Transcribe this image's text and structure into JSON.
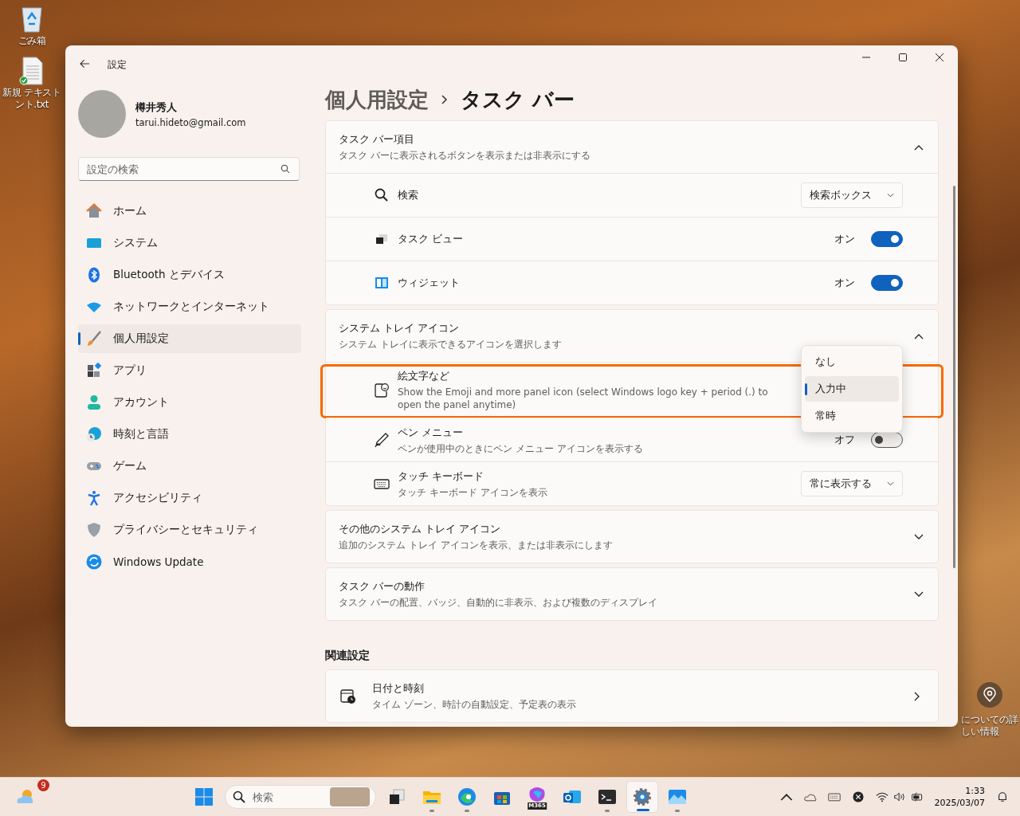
{
  "desktop": {
    "icons": [
      {
        "kind": "recycle-bin",
        "lines": [
          "ごみ箱"
        ]
      },
      {
        "kind": "text-file",
        "lines": [
          "新規 テキスト",
          "ント.txt"
        ]
      }
    ],
    "spotlight": {
      "lines": [
        "についての詳",
        "しい情報"
      ]
    }
  },
  "window": {
    "title": "設定"
  },
  "account": {
    "name": "樽井秀人",
    "email": "tarui.hideto@gmail.com"
  },
  "search": {
    "placeholder": "設定の検索"
  },
  "nav": [
    {
      "kind": "home",
      "label": "ホーム",
      "selected": false
    },
    {
      "kind": "system",
      "label": "システム",
      "selected": false
    },
    {
      "kind": "bluetooth",
      "label": "Bluetooth とデバイス",
      "selected": false
    },
    {
      "kind": "network",
      "label": "ネットワークとインターネット",
      "selected": false
    },
    {
      "kind": "brush",
      "label": "個人用設定",
      "selected": true
    },
    {
      "kind": "apps",
      "label": "アプリ",
      "selected": false
    },
    {
      "kind": "account",
      "label": "アカウント",
      "selected": false
    },
    {
      "kind": "time",
      "label": "時刻と言語",
      "selected": false
    },
    {
      "kind": "gaming",
      "label": "ゲーム",
      "selected": false
    },
    {
      "kind": "accessibility",
      "label": "アクセシビリティ",
      "selected": false
    },
    {
      "kind": "shield",
      "label": "プライバシーとセキュリティ",
      "selected": false
    },
    {
      "kind": "update",
      "label": "Windows Update",
      "selected": false
    }
  ],
  "breadcrumb": {
    "parent": "個人用設定",
    "current": "タスク バー"
  },
  "sections": [
    {
      "title": "タスク バー項目",
      "subtitle": "タスク バーに表示されるボタンを表示または非表示にする",
      "expanded": true,
      "items": [
        {
          "kind": "search",
          "label": "検索",
          "control": {
            "kind": "dropdown",
            "value": "検索ボックス"
          }
        },
        {
          "kind": "task-view",
          "label": "タスク ビュー",
          "control": {
            "kind": "toggle",
            "on": true,
            "state_label": "オン"
          }
        },
        {
          "kind": "widgets",
          "label": "ウィジェット",
          "control": {
            "kind": "toggle",
            "on": true,
            "state_label": "オン"
          }
        }
      ]
    },
    {
      "title": "システム トレイ アイコン",
      "subtitle": "システム トレイに表示できるアイコンを選択します",
      "expanded": true,
      "items": [
        {
          "kind": "emoji",
          "label": "絵文字など",
          "description": "Show the Emoji and more panel icon (select Windows logo key + period (.) to open the panel anytime)",
          "highlighted": true,
          "control": {
            "kind": "dropdown-open",
            "options": [
              {
                "label": "なし",
                "selected": false
              },
              {
                "label": "入力中",
                "selected": true
              },
              {
                "label": "常時",
                "selected": false
              }
            ]
          }
        },
        {
          "kind": "pen",
          "label": "ペン メニュー",
          "description": "ペンが使用中のときにペン メニュー アイコンを表示する",
          "control": {
            "kind": "toggle",
            "on": false,
            "state_label": "オフ"
          }
        },
        {
          "kind": "keyboard",
          "label": "タッチ キーボード",
          "description": "タッチ キーボード アイコンを表示",
          "control": {
            "kind": "dropdown",
            "value": "常に表示する"
          }
        }
      ]
    },
    {
      "title": "その他のシステム トレイ アイコン",
      "subtitle": "追加のシステム トレイ アイコンを表示、または非表示にします",
      "expanded": false
    },
    {
      "title": "タスク バーの動作",
      "subtitle": "タスク バーの配置、バッジ、自動的に非表示、および複数のディスプレイ",
      "expanded": false
    }
  ],
  "related": {
    "heading": "関連設定",
    "items": [
      {
        "kind": "calendar-clock",
        "title": "日付と時刻",
        "subtitle": "タイム ゾーン、時計の自動設定、予定表の表示"
      }
    ]
  },
  "taskbar": {
    "weather_badge": "9",
    "search_placeholder": "検索",
    "apps": [
      {
        "kind": "start",
        "running": false,
        "selected": false
      },
      {
        "kind": "task-view",
        "running": false,
        "selected": false
      },
      {
        "kind": "folder",
        "running": true,
        "selected": false
      },
      {
        "kind": "edge",
        "running": true,
        "selected": false
      },
      {
        "kind": "store",
        "running": false,
        "selected": false
      },
      {
        "kind": "m365",
        "label": "M365",
        "running": false,
        "selected": false
      },
      {
        "kind": "outlook",
        "running": false,
        "selected": false
      },
      {
        "kind": "terminal",
        "running": true,
        "selected": false
      },
      {
        "kind": "gear",
        "running": true,
        "selected": true
      },
      {
        "kind": "photos",
        "running": true,
        "selected": false
      }
    ],
    "time": "1:33",
    "date": "2025/03/07"
  }
}
